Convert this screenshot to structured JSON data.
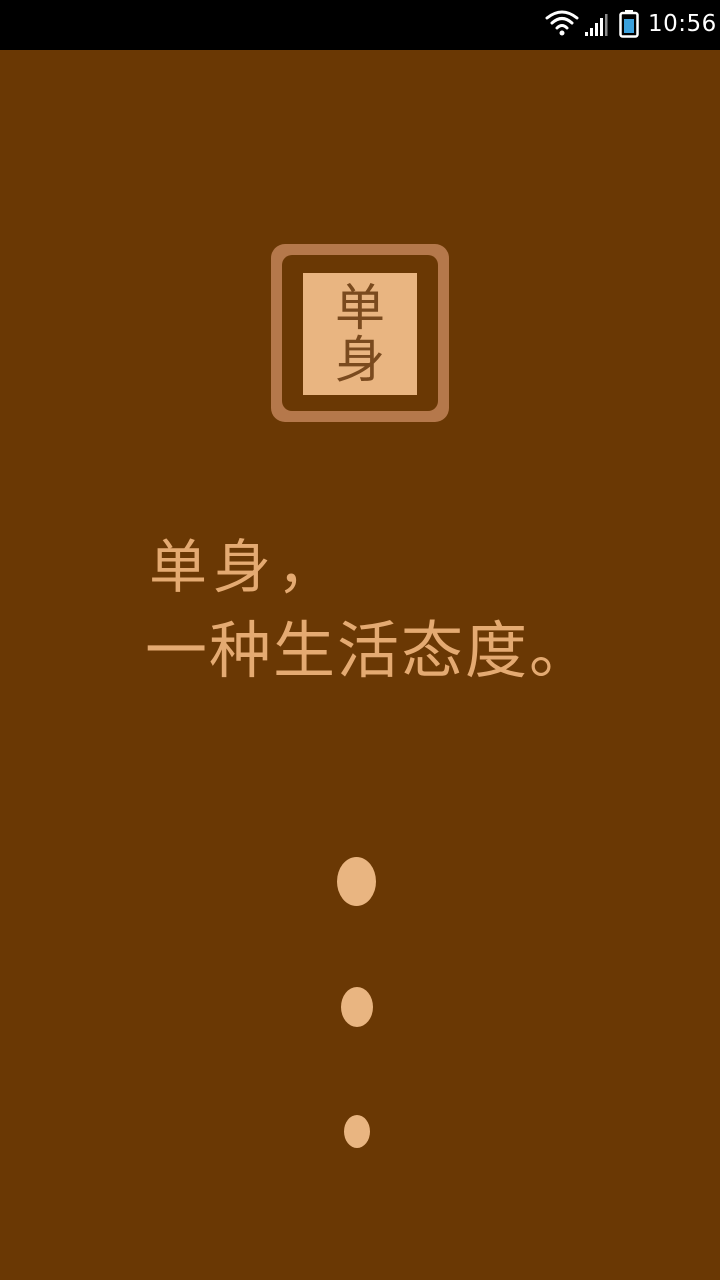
{
  "status_bar": {
    "time": "10:56",
    "icons": [
      "wifi-icon",
      "signal-icon",
      "battery-icon"
    ]
  },
  "logo": {
    "char_1": "单",
    "char_2": "身"
  },
  "slogan": {
    "line_1": "单身，",
    "line_2": "一种生活态度。"
  },
  "loading_indicator": {
    "dots": 3
  },
  "colors": {
    "background": "#6a3804",
    "accent": "#e9b581",
    "logo_border": "#b5784b",
    "text": "#e4aa72",
    "status_bar": "#000000"
  }
}
